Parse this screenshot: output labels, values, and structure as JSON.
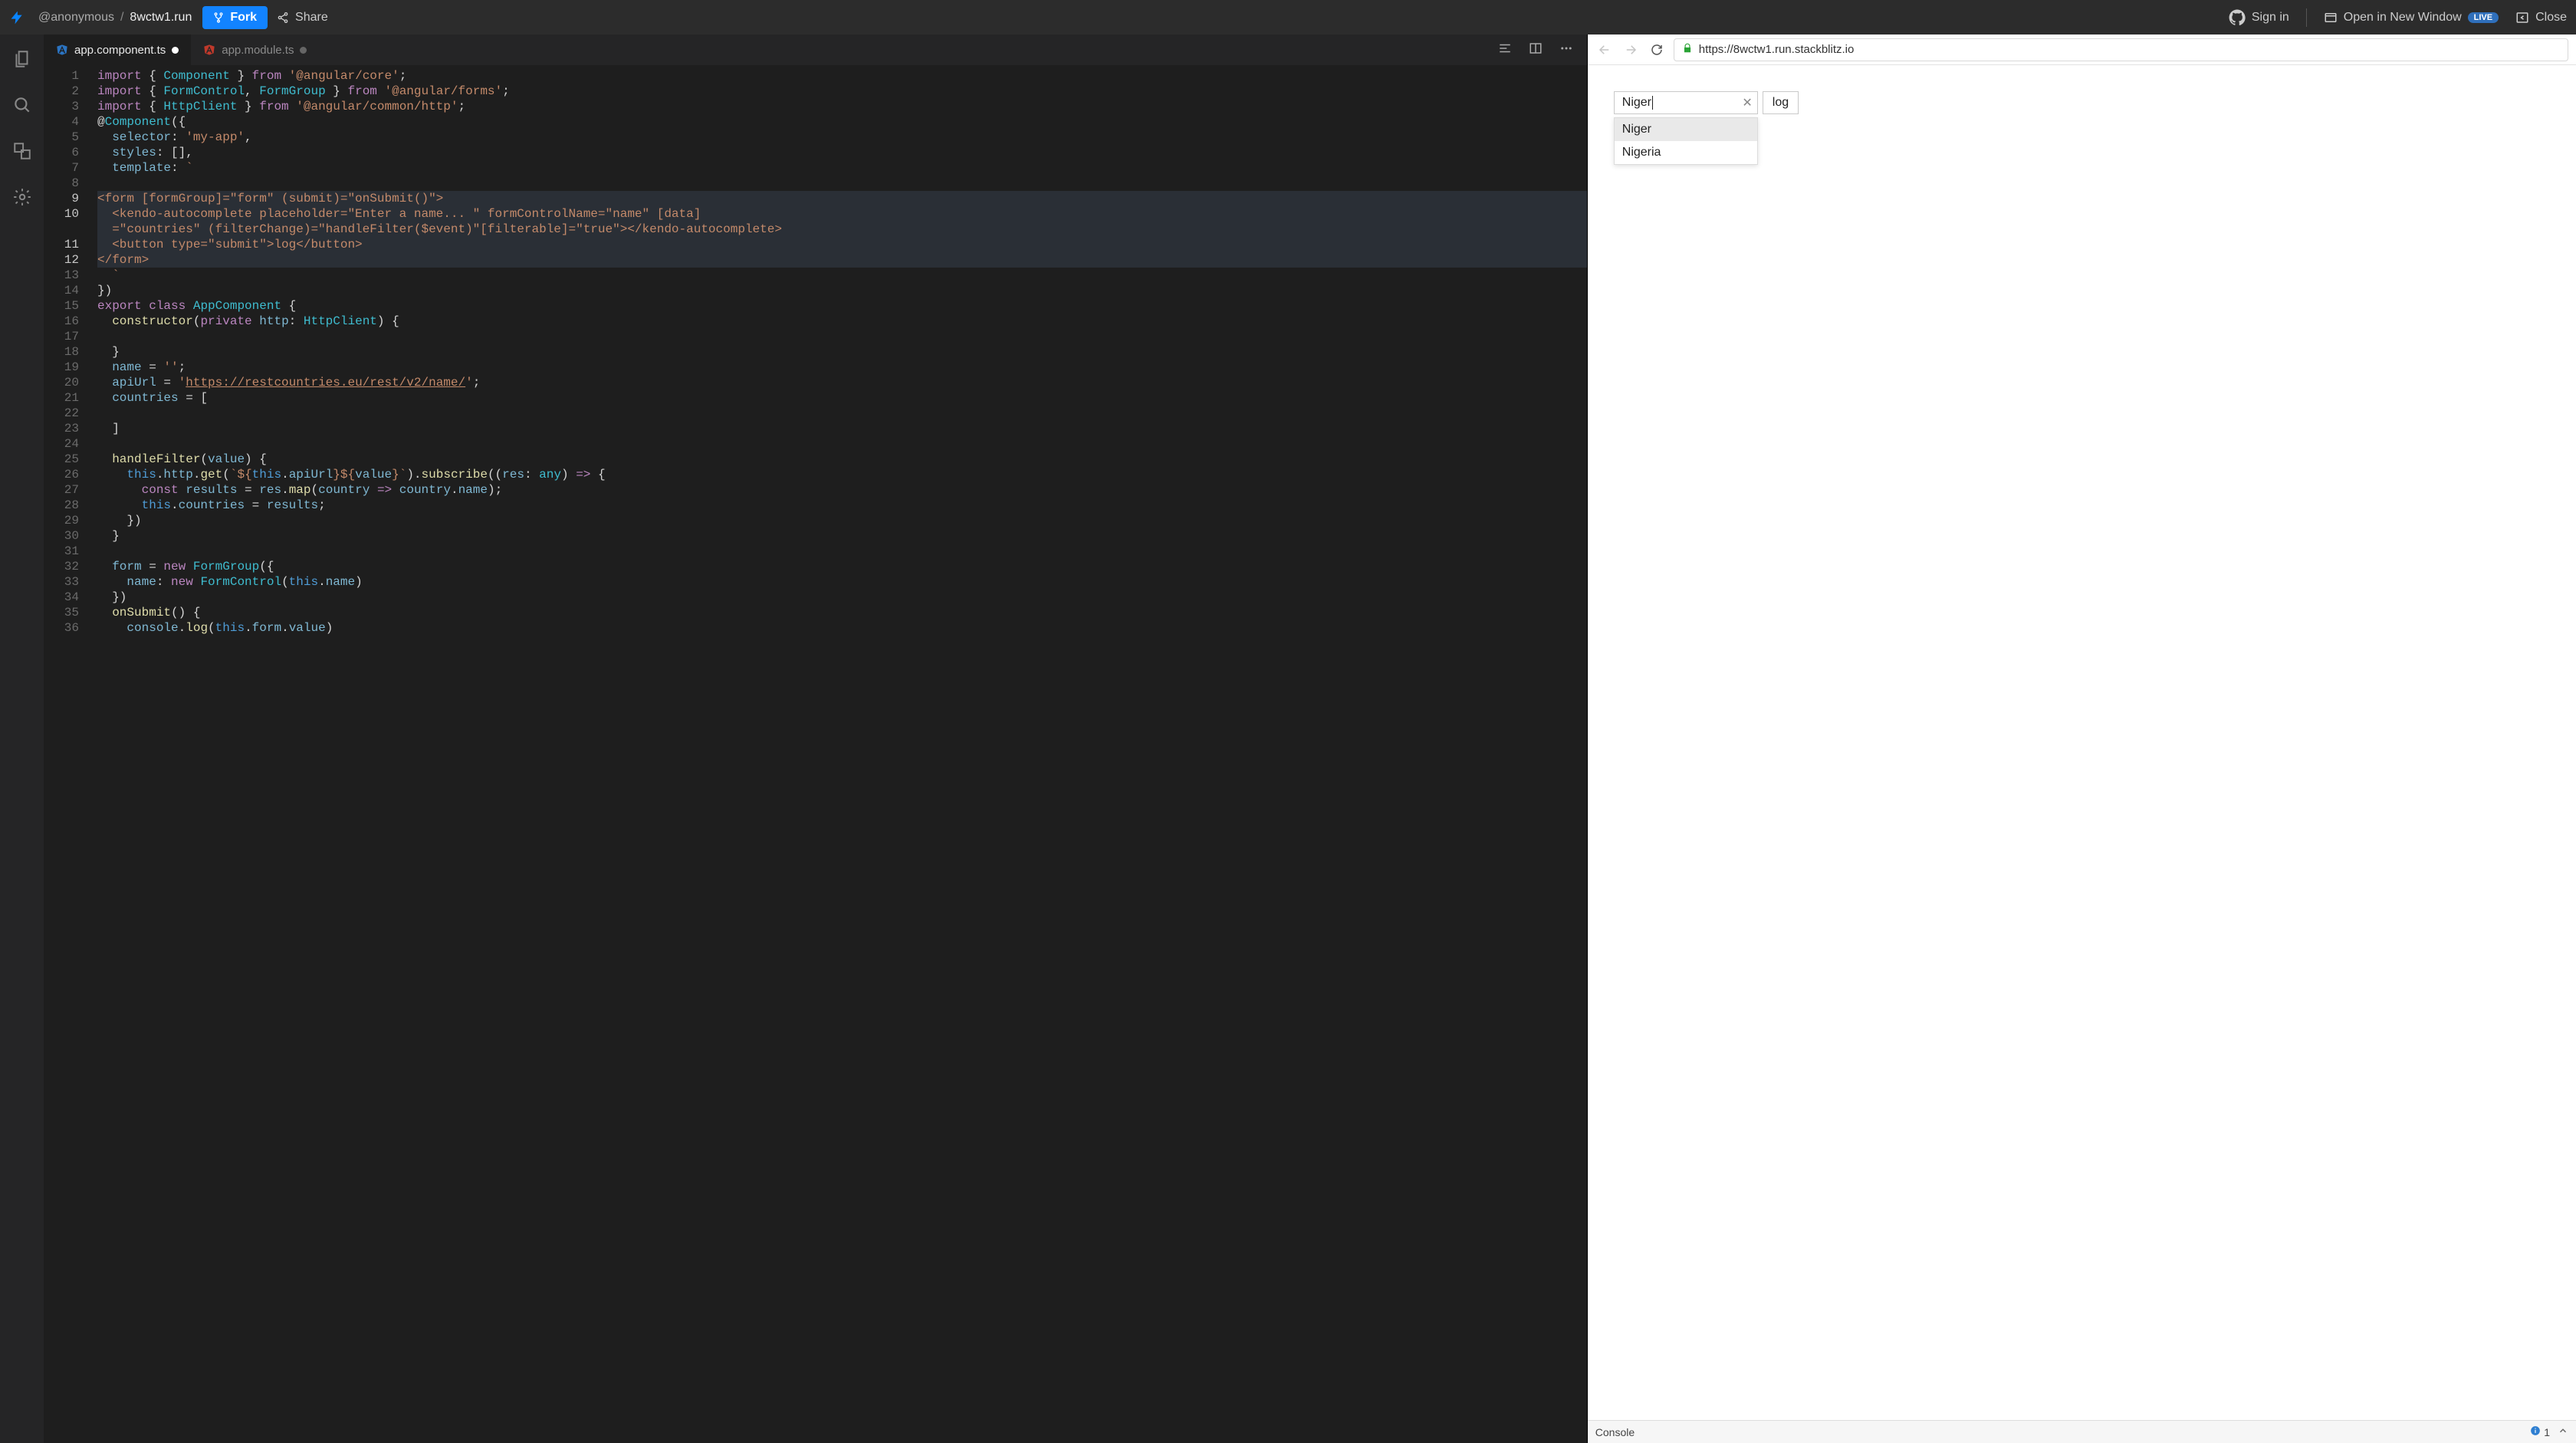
{
  "header": {
    "user": "@anonymous",
    "project": "8wctw1.run",
    "fork_label": "Fork",
    "share_label": "Share",
    "signin_label": "Sign in",
    "open_new_window_label": "Open in New Window",
    "live_badge": "LIVE",
    "close_label": "Close"
  },
  "tabs": [
    {
      "label": "app.component.ts",
      "active": true,
      "dirty": true,
      "icon": "angular"
    },
    {
      "label": "app.module.ts",
      "active": false,
      "dirty": true,
      "icon": "angular"
    }
  ],
  "code": {
    "lines": [
      {
        "n": 1,
        "tokens": [
          [
            "import",
            "kw"
          ],
          [
            " { ",
            "punc"
          ],
          [
            "Component",
            "type"
          ],
          [
            " } ",
            "punc"
          ],
          [
            "from",
            "kw"
          ],
          [
            " ",
            "punc"
          ],
          [
            "'@angular/core'",
            "str"
          ],
          [
            ";",
            "punc"
          ]
        ]
      },
      {
        "n": 2,
        "tokens": [
          [
            "import",
            "kw"
          ],
          [
            " { ",
            "punc"
          ],
          [
            "FormControl",
            "type"
          ],
          [
            ", ",
            "punc"
          ],
          [
            "FormGroup",
            "type"
          ],
          [
            " } ",
            "punc"
          ],
          [
            "from",
            "kw"
          ],
          [
            " ",
            "punc"
          ],
          [
            "'@angular/forms'",
            "str"
          ],
          [
            ";",
            "punc"
          ]
        ]
      },
      {
        "n": 3,
        "tokens": [
          [
            "import",
            "kw"
          ],
          [
            " { ",
            "punc"
          ],
          [
            "HttpClient",
            "type"
          ],
          [
            " } ",
            "punc"
          ],
          [
            "from",
            "kw"
          ],
          [
            " ",
            "punc"
          ],
          [
            "'@angular/common/http'",
            "str"
          ],
          [
            ";",
            "punc"
          ]
        ]
      },
      {
        "n": 4,
        "tokens": [
          [
            "@",
            "punc"
          ],
          [
            "Component",
            "ann"
          ],
          [
            "({",
            "punc"
          ]
        ]
      },
      {
        "n": 5,
        "tokens": [
          [
            "  ",
            "punc"
          ],
          [
            "selector",
            "var"
          ],
          [
            ": ",
            "punc"
          ],
          [
            "'my-app'",
            "str"
          ],
          [
            ",",
            "punc"
          ]
        ]
      },
      {
        "n": 6,
        "tokens": [
          [
            "  ",
            "punc"
          ],
          [
            "styles",
            "var"
          ],
          [
            ": [],",
            "punc"
          ]
        ]
      },
      {
        "n": 7,
        "tokens": [
          [
            "  ",
            "punc"
          ],
          [
            "template",
            "var"
          ],
          [
            ": ",
            "punc"
          ],
          [
            "`",
            "str"
          ]
        ]
      },
      {
        "n": 8,
        "tokens": []
      },
      {
        "n": 9,
        "hl": true,
        "tokens": [
          [
            "<form [formGroup]=\"form\" (submit)=\"onSubmit()\">",
            "str"
          ]
        ]
      },
      {
        "n": 10,
        "hl": true,
        "tokens": [
          [
            "  <kendo-autocomplete placeholder=\"Enter a name... \" formControlName=\"name\" [data]",
            "str"
          ]
        ]
      },
      {
        "n": 11,
        "hl": true,
        "nnum": "",
        "tokens": [
          [
            "  =\"countries\" (filterChange)=\"handleFilter($event)\"[filterable]=\"true\"></kendo-autocomplete>",
            "str"
          ]
        ]
      },
      {
        "n": 11,
        "hl": true,
        "tokens": [
          [
            "  <button type=\"submit\">log</button>",
            "str"
          ]
        ]
      },
      {
        "n": 12,
        "hl": true,
        "tokens": [
          [
            "</form>",
            "str"
          ]
        ]
      },
      {
        "n": 13,
        "tokens": [
          [
            "  ",
            "punc"
          ],
          [
            "`",
            "str"
          ]
        ]
      },
      {
        "n": 14,
        "tokens": [
          [
            "})",
            "punc"
          ]
        ]
      },
      {
        "n": 15,
        "tokens": [
          [
            "export",
            "kw"
          ],
          [
            " ",
            "punc"
          ],
          [
            "class",
            "kw"
          ],
          [
            " ",
            "punc"
          ],
          [
            "AppComponent",
            "type"
          ],
          [
            " {",
            "punc"
          ]
        ]
      },
      {
        "n": 16,
        "tokens": [
          [
            "  ",
            "punc"
          ],
          [
            "constructor",
            "id"
          ],
          [
            "(",
            "punc"
          ],
          [
            "private",
            "kw"
          ],
          [
            " ",
            "punc"
          ],
          [
            "http",
            "var"
          ],
          [
            ": ",
            "punc"
          ],
          [
            "HttpClient",
            "type"
          ],
          [
            ") {",
            "punc"
          ]
        ]
      },
      {
        "n": 17,
        "tokens": []
      },
      {
        "n": 18,
        "tokens": [
          [
            "  }",
            "punc"
          ]
        ]
      },
      {
        "n": 19,
        "tokens": [
          [
            "  ",
            "punc"
          ],
          [
            "name",
            "var"
          ],
          [
            " = ",
            "punc"
          ],
          [
            "''",
            "str"
          ],
          [
            ";",
            "punc"
          ]
        ]
      },
      {
        "n": 20,
        "tokens": [
          [
            "  ",
            "punc"
          ],
          [
            "apiUrl",
            "var"
          ],
          [
            " = ",
            "punc"
          ],
          [
            "'",
            "str"
          ],
          [
            "https://restcountries.eu/rest/v2/name/",
            "str url"
          ],
          [
            "'",
            "str"
          ],
          [
            ";",
            "punc"
          ]
        ]
      },
      {
        "n": 21,
        "tokens": [
          [
            "  ",
            "punc"
          ],
          [
            "countries",
            "var"
          ],
          [
            " = [",
            "punc"
          ]
        ]
      },
      {
        "n": 22,
        "tokens": []
      },
      {
        "n": 23,
        "tokens": [
          [
            "  ]",
            "punc"
          ]
        ]
      },
      {
        "n": 24,
        "tokens": []
      },
      {
        "n": 25,
        "tokens": [
          [
            "  ",
            "punc"
          ],
          [
            "handleFilter",
            "id"
          ],
          [
            "(",
            "punc"
          ],
          [
            "value",
            "var"
          ],
          [
            ") {",
            "punc"
          ]
        ]
      },
      {
        "n": 26,
        "tokens": [
          [
            "    ",
            "punc"
          ],
          [
            "this",
            "this"
          ],
          [
            ".",
            "punc"
          ],
          [
            "http",
            "var"
          ],
          [
            ".",
            "punc"
          ],
          [
            "get",
            "id"
          ],
          [
            "(",
            "punc"
          ],
          [
            "`${",
            "str"
          ],
          [
            "this",
            "this"
          ],
          [
            ".",
            "punc"
          ],
          [
            "apiUrl",
            "var"
          ],
          [
            "}${",
            "str"
          ],
          [
            "value",
            "var"
          ],
          [
            "}`",
            "str"
          ],
          [
            ").",
            "punc"
          ],
          [
            "subscribe",
            "id"
          ],
          [
            "((",
            "punc"
          ],
          [
            "res",
            "var"
          ],
          [
            ": ",
            "punc"
          ],
          [
            "any",
            "type"
          ],
          [
            ") ",
            "punc"
          ],
          [
            "=>",
            "kw"
          ],
          [
            " {",
            "punc"
          ]
        ]
      },
      {
        "n": 27,
        "tokens": [
          [
            "      ",
            "punc"
          ],
          [
            "const",
            "kw"
          ],
          [
            " ",
            "punc"
          ],
          [
            "results",
            "var"
          ],
          [
            " = ",
            "punc"
          ],
          [
            "res",
            "var"
          ],
          [
            ".",
            "punc"
          ],
          [
            "map",
            "id"
          ],
          [
            "(",
            "punc"
          ],
          [
            "country",
            "var"
          ],
          [
            " ",
            "punc"
          ],
          [
            "=>",
            "kw"
          ],
          [
            " ",
            "punc"
          ],
          [
            "country",
            "var"
          ],
          [
            ".",
            "punc"
          ],
          [
            "name",
            "var"
          ],
          [
            ");",
            "punc"
          ]
        ]
      },
      {
        "n": 28,
        "tokens": [
          [
            "      ",
            "punc"
          ],
          [
            "this",
            "this"
          ],
          [
            ".",
            "punc"
          ],
          [
            "countries",
            "var"
          ],
          [
            " = ",
            "punc"
          ],
          [
            "results",
            "var"
          ],
          [
            ";",
            "punc"
          ]
        ]
      },
      {
        "n": 29,
        "tokens": [
          [
            "    })",
            "punc"
          ]
        ]
      },
      {
        "n": 30,
        "tokens": [
          [
            "  }",
            "punc"
          ]
        ]
      },
      {
        "n": 31,
        "tokens": []
      },
      {
        "n": 32,
        "tokens": [
          [
            "  ",
            "punc"
          ],
          [
            "form",
            "var"
          ],
          [
            " = ",
            "punc"
          ],
          [
            "new",
            "kw"
          ],
          [
            " ",
            "punc"
          ],
          [
            "FormGroup",
            "type"
          ],
          [
            "({",
            "punc"
          ]
        ]
      },
      {
        "n": 33,
        "tokens": [
          [
            "    ",
            "punc"
          ],
          [
            "name",
            "var"
          ],
          [
            ": ",
            "punc"
          ],
          [
            "new",
            "kw"
          ],
          [
            " ",
            "punc"
          ],
          [
            "FormControl",
            "type"
          ],
          [
            "(",
            "punc"
          ],
          [
            "this",
            "this"
          ],
          [
            ".",
            "punc"
          ],
          [
            "name",
            "var"
          ],
          [
            ")",
            "punc"
          ]
        ]
      },
      {
        "n": 34,
        "tokens": [
          [
            "  })",
            "punc"
          ]
        ]
      },
      {
        "n": 35,
        "tokens": [
          [
            "  ",
            "punc"
          ],
          [
            "onSubmit",
            "id"
          ],
          [
            "() {",
            "punc"
          ]
        ]
      },
      {
        "n": 36,
        "tokens": [
          [
            "    ",
            "punc"
          ],
          [
            "console",
            "var"
          ],
          [
            ".",
            "punc"
          ],
          [
            "log",
            "id"
          ],
          [
            "(",
            "punc"
          ],
          [
            "this",
            "this"
          ],
          [
            ".",
            "punc"
          ],
          [
            "form",
            "var"
          ],
          [
            ".",
            "punc"
          ],
          [
            "value",
            "var"
          ],
          [
            ")",
            "punc"
          ]
        ]
      }
    ]
  },
  "preview": {
    "url": "https://8wctw1.run.stackblitz.io",
    "input_value": "Niger",
    "placeholder": "Enter a name... ",
    "log_button": "log",
    "suggestions": [
      {
        "label": "Niger",
        "selected": true
      },
      {
        "label": "Nigeria",
        "selected": false
      }
    ]
  },
  "console": {
    "label": "Console",
    "info_count": "1"
  }
}
